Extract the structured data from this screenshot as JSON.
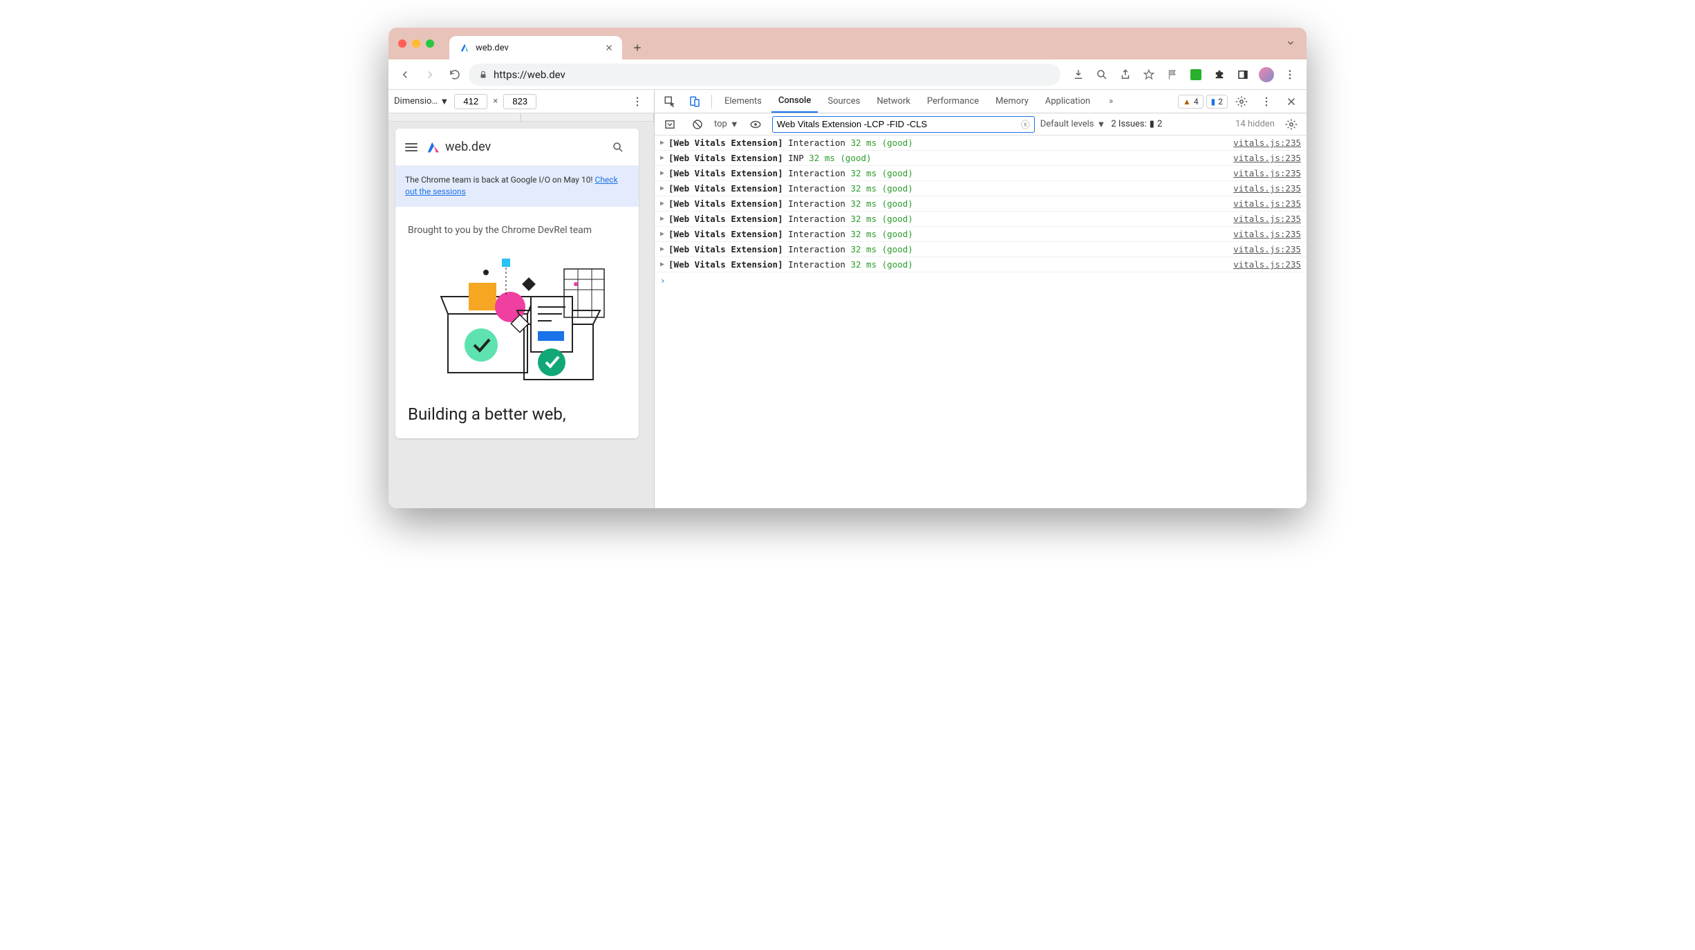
{
  "chrome": {
    "tab_title": "web.dev",
    "url": "https://web.dev",
    "url_prefix": "https://"
  },
  "device_toolbar": {
    "label": "Dimensio…",
    "width": "412",
    "height": "823"
  },
  "page": {
    "brand": "web.dev",
    "banner_text": "The Chrome team is back at Google I/O on May 10! ",
    "banner_link": "Check out the sessions",
    "subtitle": "Brought to you by the Chrome DevRel team",
    "hero": "Building a better web,"
  },
  "devtools": {
    "tabs": [
      "Elements",
      "Console",
      "Sources",
      "Network",
      "Performance",
      "Memory",
      "Application"
    ],
    "active_tab": "Console",
    "warnings_badge": "4",
    "messages_badge": "2",
    "context": "top",
    "filter_value": "Web Vitals Extension -LCP -FID -CLS",
    "levels_label": "Default levels",
    "issues_label": "2 Issues:",
    "issues_count": "2",
    "hidden_label": "14 hidden"
  },
  "logs": [
    {
      "prefix": "[Web Vitals Extension]",
      "metric": "Interaction",
      "value": "32 ms (good)",
      "src": "vitals.js:235"
    },
    {
      "prefix": "[Web Vitals Extension]",
      "metric": "INP",
      "value": "32 ms (good)",
      "src": "vitals.js:235"
    },
    {
      "prefix": "[Web Vitals Extension]",
      "metric": "Interaction",
      "value": "32 ms (good)",
      "src": "vitals.js:235"
    },
    {
      "prefix": "[Web Vitals Extension]",
      "metric": "Interaction",
      "value": "32 ms (good)",
      "src": "vitals.js:235"
    },
    {
      "prefix": "[Web Vitals Extension]",
      "metric": "Interaction",
      "value": "32 ms (good)",
      "src": "vitals.js:235"
    },
    {
      "prefix": "[Web Vitals Extension]",
      "metric": "Interaction",
      "value": "32 ms (good)",
      "src": "vitals.js:235"
    },
    {
      "prefix": "[Web Vitals Extension]",
      "metric": "Interaction",
      "value": "32 ms (good)",
      "src": "vitals.js:235"
    },
    {
      "prefix": "[Web Vitals Extension]",
      "metric": "Interaction",
      "value": "32 ms (good)",
      "src": "vitals.js:235"
    },
    {
      "prefix": "[Web Vitals Extension]",
      "metric": "Interaction",
      "value": "32 ms (good)",
      "src": "vitals.js:235"
    }
  ]
}
